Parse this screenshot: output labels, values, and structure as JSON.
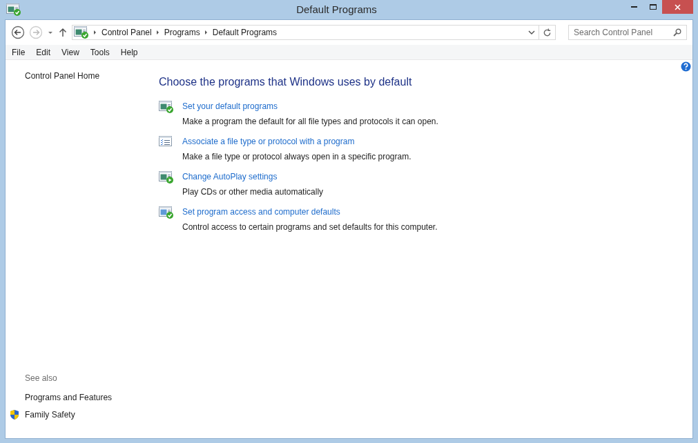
{
  "window": {
    "title": "Default Programs"
  },
  "address_bar": {
    "breadcrumbs": [
      "Control Panel",
      "Programs",
      "Default Programs"
    ]
  },
  "search": {
    "placeholder": "Search Control Panel"
  },
  "menu": [
    "File",
    "Edit",
    "View",
    "Tools",
    "Help"
  ],
  "sidebar": {
    "home_link": "Control Panel Home",
    "see_also_title": "See also",
    "see_also": [
      {
        "label": "Programs and Features",
        "shield": false
      },
      {
        "label": "Family Safety",
        "shield": true
      }
    ]
  },
  "main": {
    "heading": "Choose the programs that Windows uses by default",
    "tasks": [
      {
        "kind": "check",
        "link": "Set your default programs",
        "description": "Make a program the default for all file types and protocols it can open."
      },
      {
        "kind": "list",
        "link": "Associate a file type or protocol with a program",
        "description": "Make a file type or protocol always open in a specific program."
      },
      {
        "kind": "play",
        "link": "Change AutoPlay settings",
        "description": "Play CDs or other media automatically"
      },
      {
        "kind": "access",
        "link": "Set program access and computer defaults",
        "description": "Control access to certain programs and set defaults for this computer."
      }
    ]
  }
}
